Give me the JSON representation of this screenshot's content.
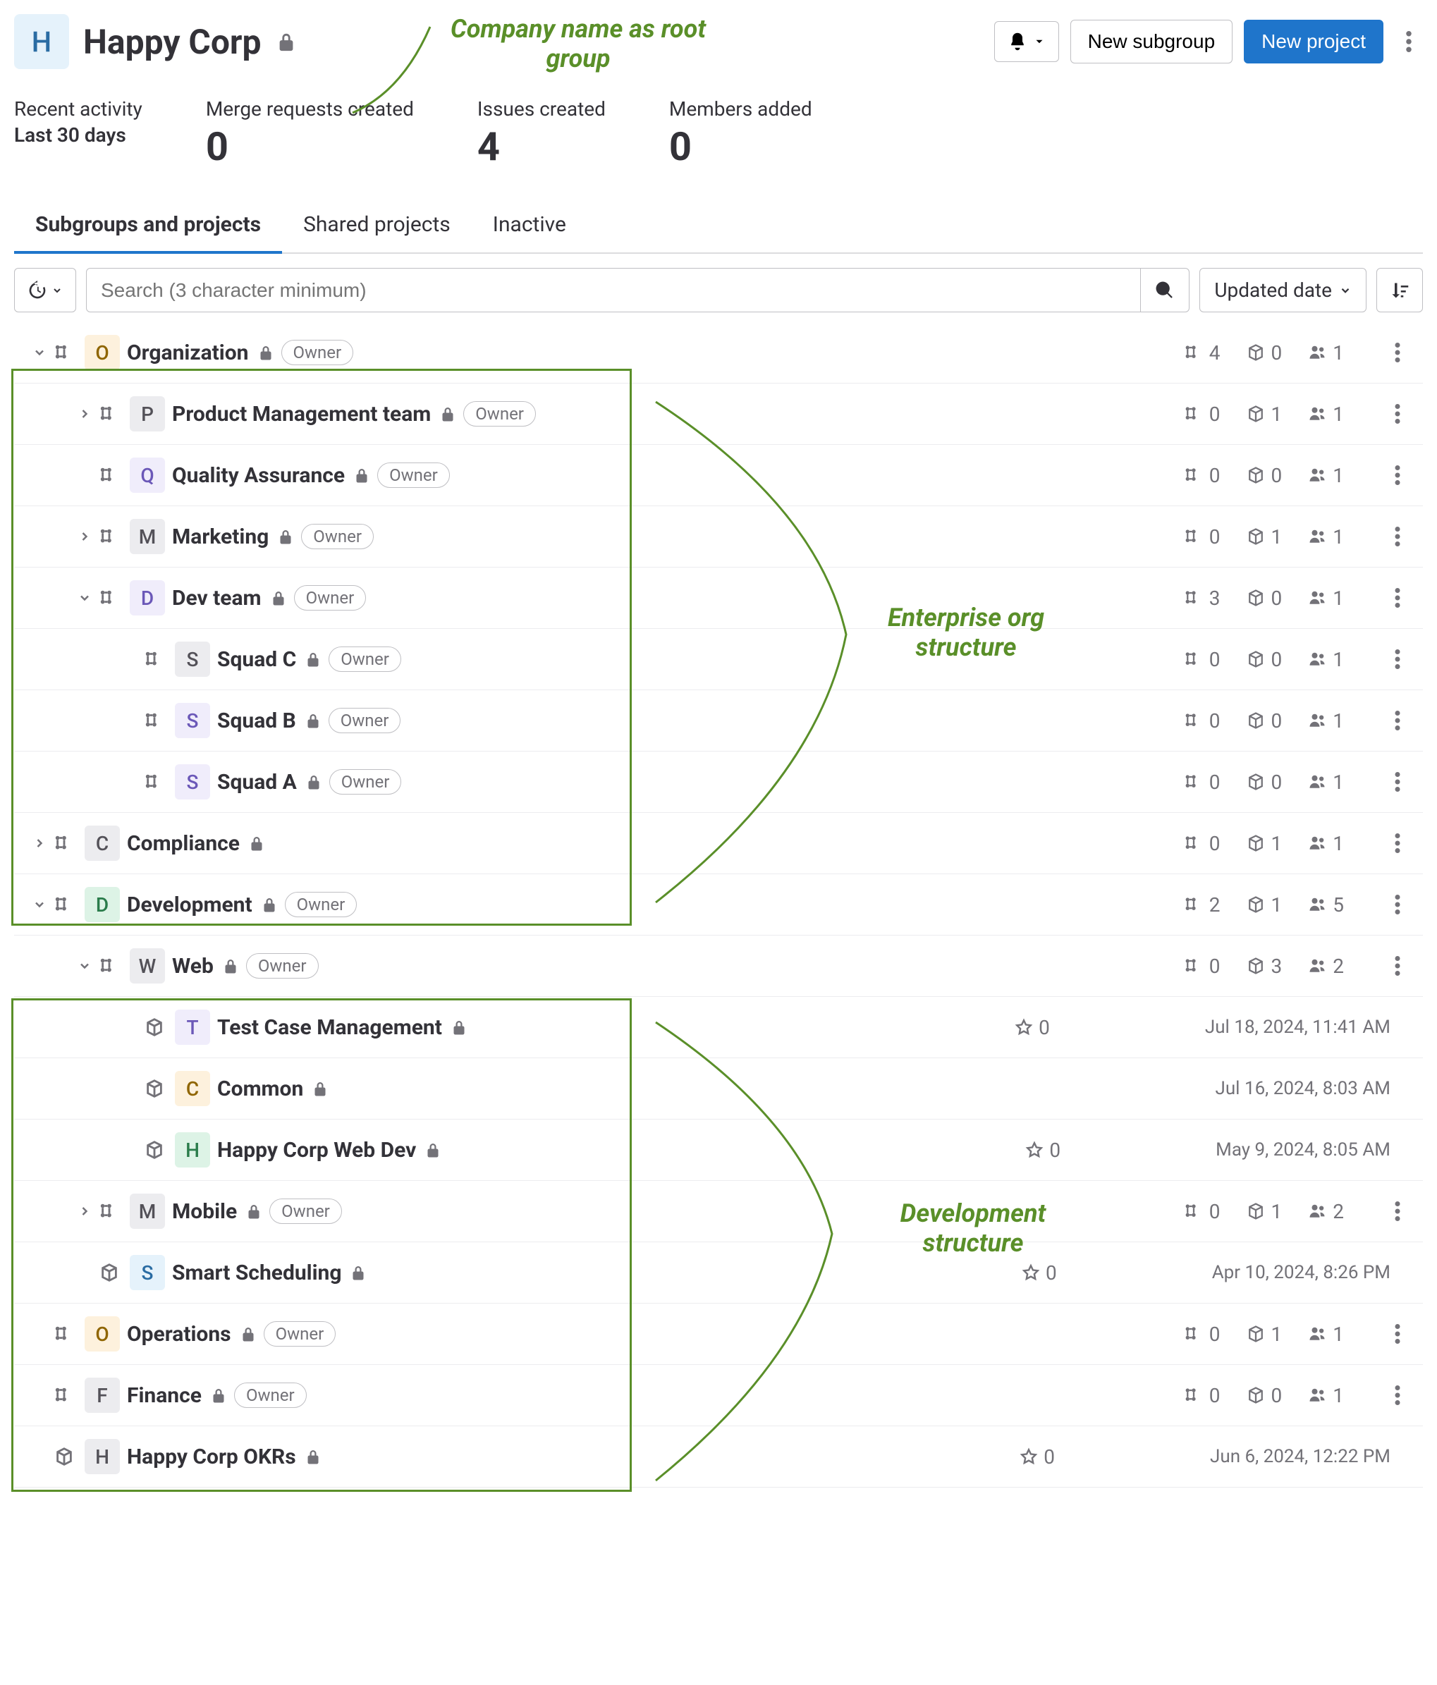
{
  "header": {
    "avatar_letter": "H",
    "title": "Happy Corp",
    "notification_label": "",
    "new_subgroup_label": "New subgroup",
    "new_project_label": "New project"
  },
  "stats": {
    "activity_label": "Recent activity",
    "period_label": "Last 30 days",
    "mr_label": "Merge requests created",
    "mr_value": "0",
    "issues_label": "Issues created",
    "issues_value": "4",
    "members_label": "Members added",
    "members_value": "0"
  },
  "tabs": {
    "subgroups": "Subgroups and projects",
    "shared": "Shared projects",
    "inactive": "Inactive"
  },
  "search": {
    "placeholder": "Search (3 character minimum)",
    "sort_label": "Updated date"
  },
  "annotations": {
    "root": "Company name as root group",
    "org": "Enterprise org structure",
    "dev": "Development structure"
  },
  "rows": [
    {
      "indent": 0,
      "expand": "down",
      "type": "group",
      "letter": "O",
      "av_bg": "#fdf1dd",
      "av_fg": "#8f6500",
      "name": "Organization",
      "owner": true,
      "subgroups": 4,
      "projects": 0,
      "members": 1
    },
    {
      "indent": 1,
      "expand": "right",
      "type": "group",
      "letter": "P",
      "av_bg": "#ececef",
      "av_fg": "#535158",
      "name": "Product Management team",
      "owner": true,
      "subgroups": 0,
      "projects": 1,
      "members": 1
    },
    {
      "indent": 1,
      "expand": "none",
      "type": "group",
      "letter": "Q",
      "av_bg": "#f0edfb",
      "av_fg": "#6b58b8",
      "name": "Quality Assurance",
      "owner": true,
      "subgroups": 0,
      "projects": 0,
      "members": 1
    },
    {
      "indent": 1,
      "expand": "right",
      "type": "group",
      "letter": "M",
      "av_bg": "#ececef",
      "av_fg": "#535158",
      "name": "Marketing",
      "owner": true,
      "subgroups": 0,
      "projects": 1,
      "members": 1
    },
    {
      "indent": 1,
      "expand": "down",
      "type": "group",
      "letter": "D",
      "av_bg": "#f0edfb",
      "av_fg": "#6b58b8",
      "name": "Dev team",
      "owner": true,
      "subgroups": 3,
      "projects": 0,
      "members": 1
    },
    {
      "indent": 2,
      "expand": "none",
      "type": "group",
      "letter": "S",
      "av_bg": "#ececef",
      "av_fg": "#535158",
      "name": "Squad C",
      "owner": true,
      "subgroups": 0,
      "projects": 0,
      "members": 1
    },
    {
      "indent": 2,
      "expand": "none",
      "type": "group",
      "letter": "S",
      "av_bg": "#f0edfb",
      "av_fg": "#6b58b8",
      "name": "Squad B",
      "owner": true,
      "subgroups": 0,
      "projects": 0,
      "members": 1
    },
    {
      "indent": 2,
      "expand": "none",
      "type": "group",
      "letter": "S",
      "av_bg": "#f0edfb",
      "av_fg": "#6b58b8",
      "name": "Squad A",
      "owner": true,
      "subgroups": 0,
      "projects": 0,
      "members": 1
    },
    {
      "indent": 0,
      "expand": "right",
      "type": "group",
      "letter": "C",
      "av_bg": "#ececef",
      "av_fg": "#535158",
      "name": "Compliance",
      "owner": false,
      "subgroups": 0,
      "projects": 1,
      "members": 1
    },
    {
      "indent": 0,
      "expand": "down",
      "type": "group",
      "letter": "D",
      "av_bg": "#ddf3e6",
      "av_fg": "#2a7c4b",
      "name": "Development",
      "owner": true,
      "subgroups": 2,
      "projects": 1,
      "members": 5
    },
    {
      "indent": 1,
      "expand": "down",
      "type": "group",
      "letter": "W",
      "av_bg": "#ececef",
      "av_fg": "#535158",
      "name": "Web",
      "owner": true,
      "subgroups": 0,
      "projects": 3,
      "members": 2
    },
    {
      "indent": 2,
      "expand": "none",
      "type": "project",
      "letter": "T",
      "av_bg": "#f0edfb",
      "av_fg": "#6b58b8",
      "name": "Test Case Management",
      "stars": 0,
      "timestamp": "Jul 18, 2024, 11:41 AM"
    },
    {
      "indent": 2,
      "expand": "none",
      "type": "project",
      "letter": "C",
      "av_bg": "#fdf1dd",
      "av_fg": "#8f6500",
      "name": "Common",
      "timestamp": "Jul 16, 2024, 8:03 AM"
    },
    {
      "indent": 2,
      "expand": "none",
      "type": "project",
      "letter": "H",
      "av_bg": "#ddf3e6",
      "av_fg": "#2a7c4b",
      "name": "Happy Corp Web Dev",
      "stars": 0,
      "timestamp": "May 9, 2024, 8:05 AM"
    },
    {
      "indent": 1,
      "expand": "right",
      "type": "group",
      "letter": "M",
      "av_bg": "#ececef",
      "av_fg": "#535158",
      "name": "Mobile",
      "owner": true,
      "subgroups": 0,
      "projects": 1,
      "members": 2
    },
    {
      "indent": 1,
      "expand": "none",
      "type": "project",
      "letter": "S",
      "av_bg": "#e5f2fb",
      "av_fg": "#2a6ca3",
      "name": "Smart Scheduling",
      "stars": 0,
      "timestamp": "Apr 10, 2024, 8:26 PM"
    },
    {
      "indent": 0,
      "expand": "none",
      "type": "group",
      "letter": "O",
      "av_bg": "#fdf1dd",
      "av_fg": "#8f6500",
      "name": "Operations",
      "owner": true,
      "subgroups": 0,
      "projects": 1,
      "members": 1
    },
    {
      "indent": 0,
      "expand": "none",
      "type": "group",
      "letter": "F",
      "av_bg": "#ececef",
      "av_fg": "#535158",
      "name": "Finance",
      "owner": true,
      "subgroups": 0,
      "projects": 0,
      "members": 1
    },
    {
      "indent": 0,
      "expand": "none",
      "type": "project",
      "letter": "H",
      "av_bg": "#ececef",
      "av_fg": "#535158",
      "name": "Happy Corp OKRs",
      "stars": 0,
      "timestamp": "Jun 6, 2024, 12:22 PM"
    }
  ]
}
